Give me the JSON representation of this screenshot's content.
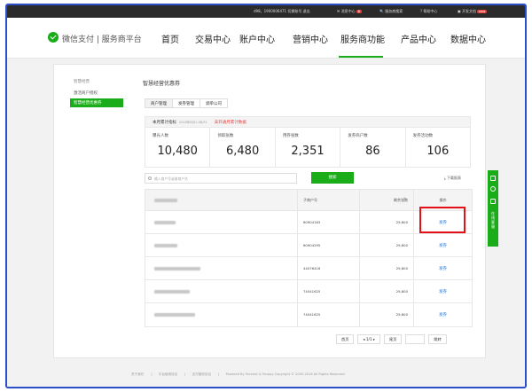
{
  "topbar": {
    "account": "d98，1900006471 切换账号 退出",
    "message_center": "消息中心",
    "message_badge": "8",
    "support": "服务商搜索",
    "help": "帮助中心",
    "dev_docs": "开发文档",
    "dev_badge": "new"
  },
  "navbar": {
    "brand": "微信支付 | 服务商平台",
    "items": [
      "首页",
      "交易中心",
      "账户中心",
      "营销中心",
      "服务商功能",
      "产品中心",
      "数据中心"
    ],
    "active_index": 4
  },
  "sidebar": {
    "title": "智慧经营",
    "link": "激活商户授权",
    "active": "智慧经营优惠券"
  },
  "page": {
    "title": "智慧经营优惠券",
    "tabs": [
      "商户管理",
      "发券管理",
      "调单公司"
    ],
    "active_tab": 0
  },
  "summary": {
    "heading": "本月累计指标",
    "date": "2016年8月1-08/31",
    "warning": "未开通月累计数据",
    "stats": [
      {
        "label": "曝光人数",
        "value": "10,480"
      },
      {
        "label": "领取张数",
        "value": "6,480"
      },
      {
        "label": "用券张数",
        "value": "2,351"
      },
      {
        "label": "发券商户数",
        "value": "86"
      },
      {
        "label": "发券活动数",
        "value": "106"
      }
    ]
  },
  "search": {
    "placeholder": "输入商户号或者商户名",
    "button": "搜索",
    "download": "下载报表"
  },
  "table": {
    "headers": [
      "商户名称",
      "子商户号",
      "剩余张数",
      "操作"
    ],
    "rows": [
      {
        "merchant_id": "60904163",
        "remaining": "29,800",
        "action": "发券"
      },
      {
        "merchant_id": "60904295",
        "remaining": "29,800",
        "action": "发券"
      },
      {
        "merchant_id": "44076416",
        "remaining": "29,800",
        "action": "发券"
      },
      {
        "merchant_id": "74041625",
        "remaining": "29,800",
        "action": "发券"
      },
      {
        "merchant_id": "74041625",
        "remaining": "29,800",
        "action": "发券"
      }
    ]
  },
  "pager": {
    "first": "首页",
    "indicator": "1/1",
    "last": "尾页",
    "jump": "跳转"
  },
  "footer": {
    "links": [
      "关于我们",
      "平台使用协议",
      "支付服务协议"
    ],
    "copyright": "Powered By Tencent & Tenpay   Copyright © 2005-2016 All Rights Reserved."
  },
  "float_bar": {
    "text": "在线客服"
  }
}
